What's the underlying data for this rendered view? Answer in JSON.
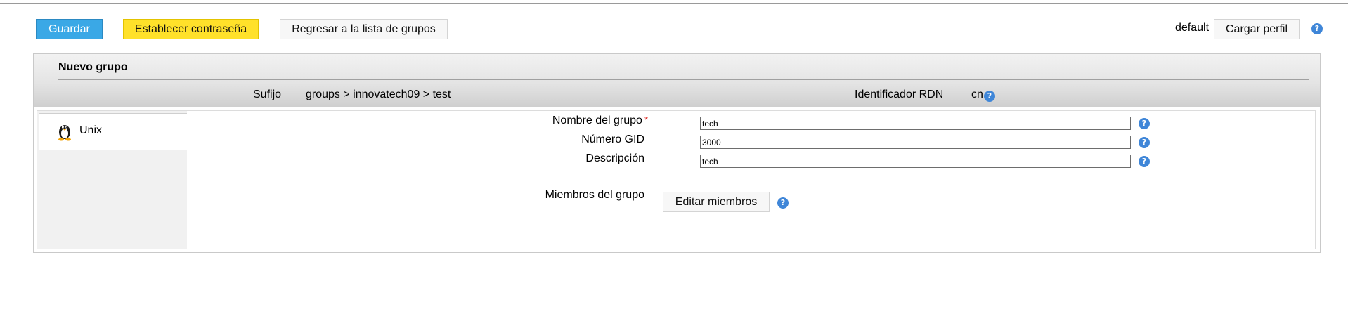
{
  "toolbar": {
    "save_label": "Guardar",
    "set_password_label": "Establecer contraseña",
    "back_label": "Regresar a la lista de grupos",
    "profile_name": "default",
    "load_profile_label": "Cargar perfil"
  },
  "panel": {
    "title": "Nuevo grupo",
    "suffix_label": "Sufijo",
    "suffix_value": "groups > innovatech09 > test",
    "rdn_label": "Identificador RDN",
    "rdn_value": "cn"
  },
  "sidebar": {
    "tabs": [
      {
        "label": "Unix",
        "icon": "tux-penguin-icon"
      }
    ]
  },
  "form": {
    "group_name": {
      "label": "Nombre del grupo",
      "required_mark": "*",
      "value": "tech"
    },
    "gid": {
      "label": "Número GID",
      "value": "3000"
    },
    "description": {
      "label": "Descripción",
      "value": "tech"
    },
    "members": {
      "label": "Miembros del grupo",
      "button_label": "Editar miembros"
    }
  },
  "help_icon_glyph": "?",
  "colors": {
    "save_button": "#3aa8e6",
    "password_button": "#ffe12a",
    "help_icon": "#3f86d8",
    "required_mark": "#e0332c"
  }
}
